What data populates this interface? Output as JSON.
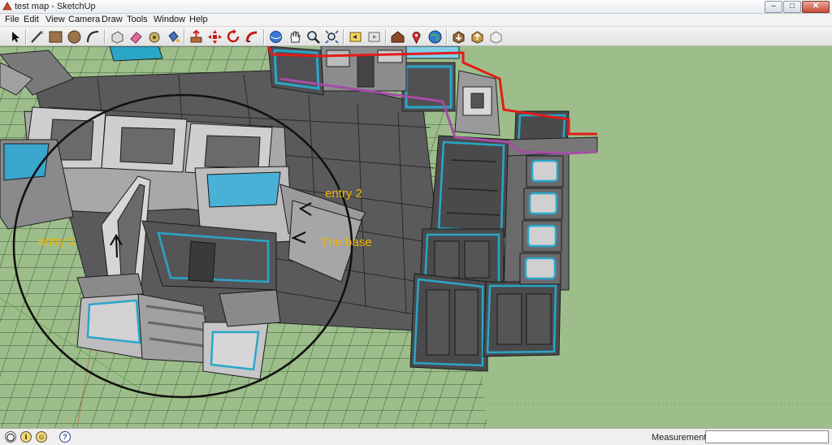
{
  "window": {
    "title": "test map - SketchUp",
    "min_label": "–",
    "max_label": "□",
    "close_label": "✕"
  },
  "menu": [
    "File",
    "Edit",
    "View",
    "Camera",
    "Draw",
    "Tools",
    "Window",
    "Help"
  ],
  "toolbar": {
    "tools": [
      "select-icon",
      "line-icon",
      "rectangle-icon",
      "circle-icon",
      "arc-icon",
      "make-component-icon",
      "eraser-icon",
      "tape-measure-icon",
      "paint-bucket-icon",
      "push-pull-icon",
      "move-icon",
      "rotate-icon",
      "follow-me-icon",
      "orbit-icon",
      "pan-icon",
      "zoom-icon",
      "zoom-extents-icon",
      "previous-view-icon",
      "next-view-icon",
      "warehouse-icon",
      "location-icon",
      "google-earth-icon",
      "get-models-icon",
      "share-model-icon",
      "import-icon"
    ]
  },
  "viewport": {
    "annotations": {
      "entry1": "entry 1",
      "entry2": "entry 2",
      "base": "The base"
    },
    "colors": {
      "grass": "#9dbe8a",
      "annotation": "#f0b400",
      "grid": "#1a3a1a",
      "accent_blue": "#2aa6c8",
      "red_line": "#e41b1b",
      "purple_line": "#a64ca6"
    }
  },
  "statusbar": {
    "icons": [
      "geo-location-icon",
      "credits-icon",
      "help-icon"
    ],
    "measurements_label": "Measurements",
    "measurements_value": ""
  }
}
